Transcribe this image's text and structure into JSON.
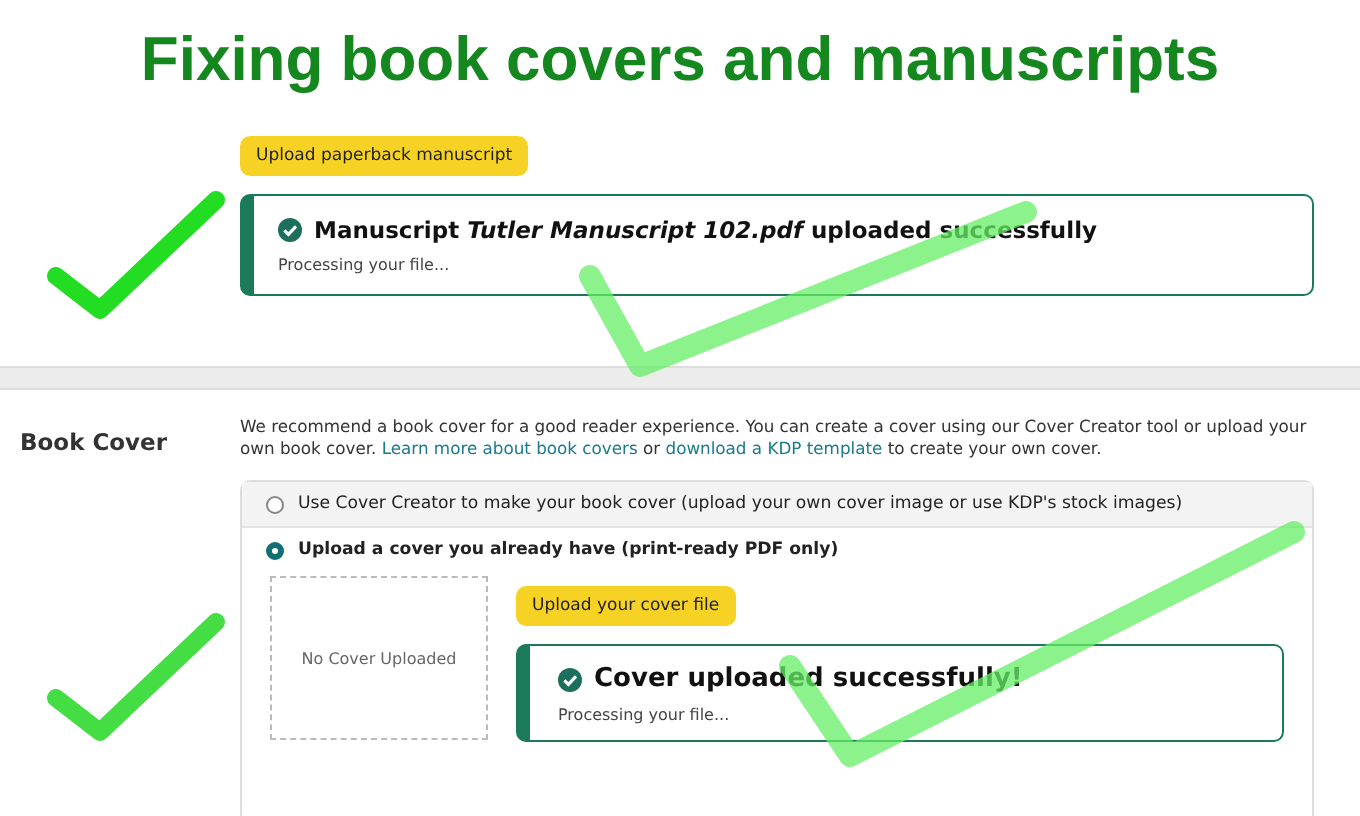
{
  "headline": "Fixing book covers and manuscripts",
  "manuscript": {
    "upload_button": "Upload paperback manuscript",
    "alert": {
      "message": "Manuscript *Tutler Manuscript 102.pdf* uploaded successfully",
      "detail": "Processing your file..."
    }
  },
  "book_cover": {
    "label": "Book Cover",
    "description": [
      {
        "kind": "text",
        "text": "We recommend a book cover for a good reader experience. You can create a cover using our Cover Creator tool or upload your own book cover. "
      },
      {
        "kind": "link",
        "text": "Learn more about book covers"
      },
      {
        "kind": "text",
        "text": " or "
      },
      {
        "kind": "link",
        "text": "download a KDP template"
      },
      {
        "kind": "text",
        "text": " to create your own cover."
      }
    ],
    "options": [
      {
        "label": "Use Cover Creator to make your book cover (upload your own cover image or use KDP's stock images)",
        "selected": false
      },
      {
        "label": "Upload a cover you already have (print-ready PDF only)",
        "selected": true
      }
    ],
    "cover_placeholder": "No Cover Uploaded",
    "upload_button": "Upload your cover file",
    "alert": {
      "message": "Cover uploaded successfully!",
      "detail": "Processing your file..."
    }
  }
}
